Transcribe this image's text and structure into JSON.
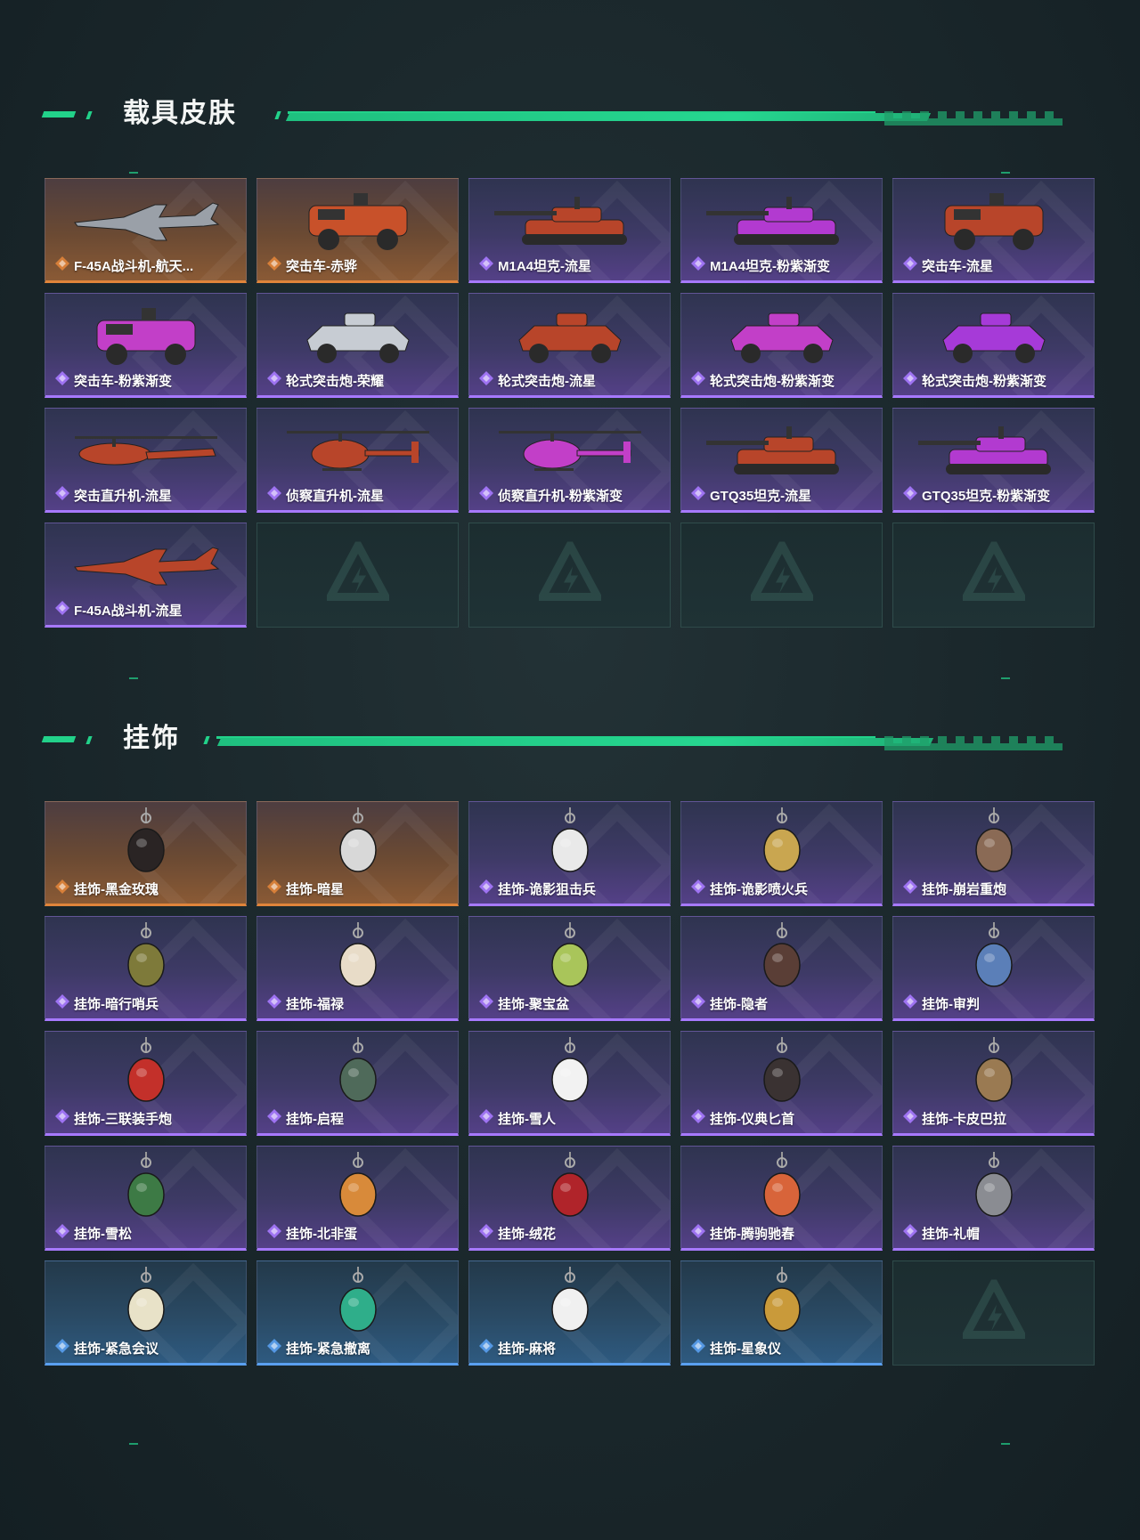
{
  "colors": {
    "accent": "#22d28a",
    "orange_rarity": "#e0843a",
    "purple_rarity": "#a779ff",
    "blue_rarity": "#5aa0f0"
  },
  "sections": [
    {
      "title": "载具皮肤",
      "items": [
        {
          "label": "F-45A战斗机-航天...",
          "rarity": "orange",
          "icon": "jet-icon",
          "color": "#9aa0a8"
        },
        {
          "label": "突击车-赤骅",
          "rarity": "orange",
          "icon": "armored-car-icon",
          "color": "#c8512a"
        },
        {
          "label": "M1A4坦克-流星",
          "rarity": "purple",
          "icon": "tank-icon",
          "color": "#b8452a"
        },
        {
          "label": "M1A4坦克-粉紫渐变",
          "rarity": "purple",
          "icon": "tank-icon",
          "color": "#b23ad0"
        },
        {
          "label": "突击车-流星",
          "rarity": "purple",
          "icon": "armored-car-icon",
          "color": "#b8452a"
        },
        {
          "label": "突击车-粉紫渐变",
          "rarity": "purple",
          "icon": "armored-car-icon",
          "color": "#c23fc8"
        },
        {
          "label": "轮式突击炮-荣耀",
          "rarity": "purple",
          "icon": "wheeled-assault-gun-icon",
          "color": "#c7ccd3"
        },
        {
          "label": "轮式突击炮-流星",
          "rarity": "purple",
          "icon": "wheeled-assault-gun-icon",
          "color": "#b8452a"
        },
        {
          "label": "轮式突击炮-粉紫渐变",
          "rarity": "purple",
          "icon": "wheeled-assault-gun-icon",
          "color": "#c23fc8"
        },
        {
          "label": "轮式突击炮-粉紫渐变",
          "rarity": "purple",
          "icon": "wheeled-assault-gun-icon",
          "color": "#a63ad8"
        },
        {
          "label": "突击直升机-流星",
          "rarity": "purple",
          "icon": "attack-helicopter-icon",
          "color": "#b8452a"
        },
        {
          "label": "侦察直升机-流星",
          "rarity": "purple",
          "icon": "scout-helicopter-icon",
          "color": "#b8452a"
        },
        {
          "label": "侦察直升机-粉紫渐变",
          "rarity": "purple",
          "icon": "scout-helicopter-icon",
          "color": "#c23fc8"
        },
        {
          "label": "GTQ35坦克-流星",
          "rarity": "purple",
          "icon": "tank-icon",
          "color": "#b8452a"
        },
        {
          "label": "GTQ35坦克-粉紫渐变",
          "rarity": "purple",
          "icon": "tank-icon",
          "color": "#b23ad0"
        },
        {
          "label": "F-45A战斗机-流星",
          "rarity": "purple",
          "icon": "jet-icon",
          "color": "#b8452a"
        },
        {
          "empty": true
        },
        {
          "empty": true
        },
        {
          "empty": true
        },
        {
          "empty": true
        }
      ]
    },
    {
      "title": "挂饰",
      "items": [
        {
          "label": "挂饰-黑金玫瑰",
          "rarity": "orange",
          "icon": "black-gold-rose-charm-icon",
          "color": "#2a2424"
        },
        {
          "label": "挂饰-暗星",
          "rarity": "orange",
          "icon": "dark-star-charm-icon",
          "color": "#d8d8d8"
        },
        {
          "label": "挂饰-诡影狙击兵",
          "rarity": "purple",
          "icon": "sniper-charm-icon",
          "color": "#e9e9e9"
        },
        {
          "label": "挂饰-诡影喷火兵",
          "rarity": "purple",
          "icon": "flamethrower-charm-icon",
          "color": "#c9a650"
        },
        {
          "label": "挂饰-崩岩重炮",
          "rarity": "purple",
          "icon": "heavy-gunner-charm-icon",
          "color": "#8a6a55"
        },
        {
          "label": "挂饰-暗行哨兵",
          "rarity": "purple",
          "icon": "sentinel-charm-icon",
          "color": "#7e7a3a"
        },
        {
          "label": "挂饰-福禄",
          "rarity": "purple",
          "icon": "gourd-charm-icon",
          "color": "#e8dcc8"
        },
        {
          "label": "挂饰-聚宝盆",
          "rarity": "purple",
          "icon": "treasure-bowl-charm-icon",
          "color": "#a9c55a"
        },
        {
          "label": "挂饰-隐者",
          "rarity": "purple",
          "icon": "hermit-card-charm-icon",
          "color": "#5a3e36"
        },
        {
          "label": "挂饰-审判",
          "rarity": "purple",
          "icon": "judgement-card-charm-icon",
          "color": "#5b7fb8"
        },
        {
          "label": "挂饰-三联装手炮",
          "rarity": "purple",
          "icon": "hand-cannon-charm-icon",
          "color": "#c3302a"
        },
        {
          "label": "挂饰-启程",
          "rarity": "purple",
          "icon": "departure-ring-charm-icon",
          "color": "#4f6a5a"
        },
        {
          "label": "挂饰-雪人",
          "rarity": "purple",
          "icon": "snowman-charm-icon",
          "color": "#f2f2f2"
        },
        {
          "label": "挂饰-仪典匕首",
          "rarity": "purple",
          "icon": "dagger-charm-icon",
          "color": "#3a3232"
        },
        {
          "label": "挂饰-卡皮巴拉",
          "rarity": "purple",
          "icon": "capybara-charm-icon",
          "color": "#9a7a52"
        },
        {
          "label": "挂饰-雪松",
          "rarity": "purple",
          "icon": "snow-pine-charm-icon",
          "color": "#3d7a45"
        },
        {
          "label": "挂饰-北非蛋",
          "rarity": "purple",
          "icon": "shakshuka-charm-icon",
          "color": "#d88a3a"
        },
        {
          "label": "挂饰-绒花",
          "rarity": "purple",
          "icon": "velvet-flower-charm-icon",
          "color": "#b0242a"
        },
        {
          "label": "挂饰-腾驹驰春",
          "rarity": "purple",
          "icon": "carriage-charm-icon",
          "color": "#d8643a"
        },
        {
          "label": "挂饰-礼帽",
          "rarity": "purple",
          "icon": "top-hat-charm-icon",
          "color": "#8a8c92"
        },
        {
          "label": "挂饰-紧急会议",
          "rarity": "blue",
          "icon": "emergency-meeting-charm-icon",
          "color": "#e8e2c8"
        },
        {
          "label": "挂饰-紧急撤离",
          "rarity": "blue",
          "icon": "emergency-evac-charm-icon",
          "color": "#2fae8a"
        },
        {
          "label": "挂饰-麻将",
          "rarity": "blue",
          "icon": "mahjong-tile-charm-icon",
          "color": "#f0f0f0"
        },
        {
          "label": "挂饰-星象仪",
          "rarity": "blue",
          "icon": "astrolabe-charm-icon",
          "color": "#c99a3a"
        },
        {
          "empty": true
        }
      ]
    }
  ]
}
